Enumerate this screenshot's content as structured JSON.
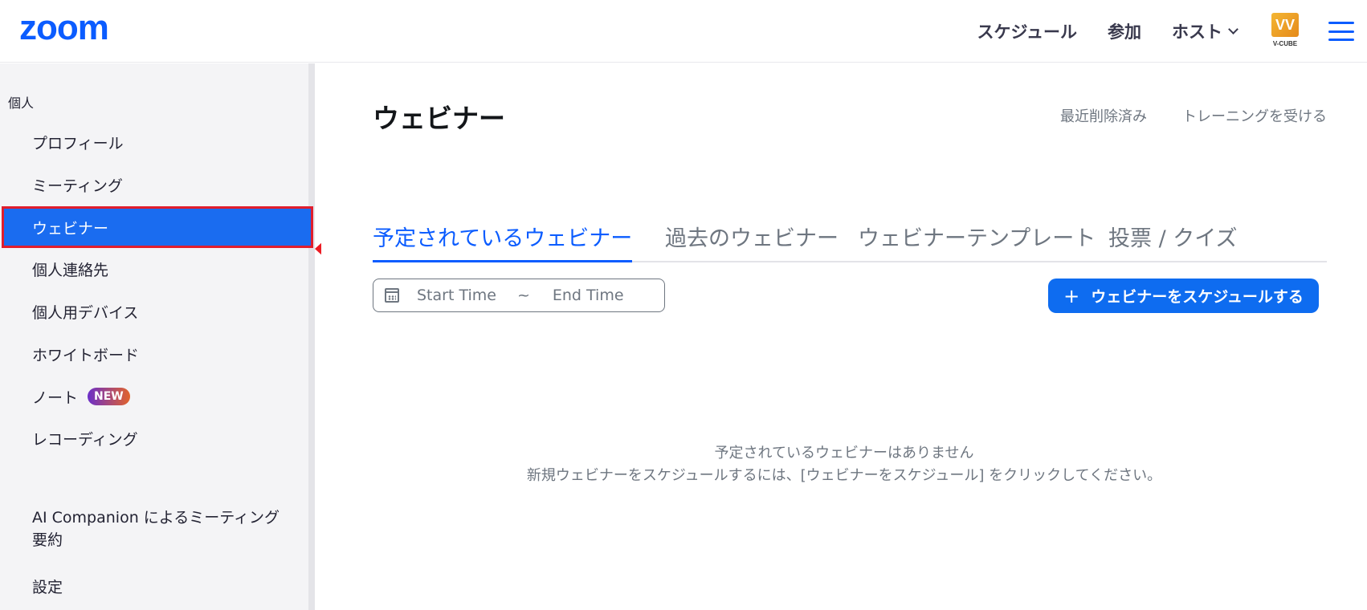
{
  "header": {
    "logo": "zoom",
    "nav": {
      "schedule": "スケジュール",
      "join": "参加",
      "host": "ホスト"
    },
    "vcube_logo_text": "V-CUBE",
    "vcube_mark": "VV"
  },
  "sidebar": {
    "section": "個人",
    "items": [
      {
        "label": "プロフィール"
      },
      {
        "label": "ミーティング"
      },
      {
        "label": "ウェビナー"
      },
      {
        "label": "個人連絡先"
      },
      {
        "label": "個人用デバイス"
      },
      {
        "label": "ホワイトボード"
      },
      {
        "label": "ノート",
        "badge": "NEW"
      },
      {
        "label": "レコーディング"
      },
      {
        "label": "AI Companion によるミーティング要約"
      },
      {
        "label": "設定"
      }
    ]
  },
  "main": {
    "title": "ウェビナー",
    "links": {
      "recently_deleted": "最近削除済み",
      "training": "トレーニングを受ける"
    },
    "tabs": [
      {
        "label": "予定されているウェビナー"
      },
      {
        "label": "過去のウェビナー"
      },
      {
        "label": "ウェビナーテンプレート"
      },
      {
        "label": "投票 / クイズ"
      }
    ],
    "date_range": {
      "start": "Start Time",
      "separator": "~",
      "end": "End Time"
    },
    "schedule_button": {
      "icon": "+",
      "label": "ウェビナーをスケジュールする"
    },
    "empty_state": {
      "line1": "予定されているウェビナーはありません",
      "line2": "新規ウェビナーをスケジュールするには、[ウェビナーをスケジュール] をクリックしてください。"
    }
  },
  "colors": {
    "accent": "#0b5cff",
    "active_item": "#1a6cf0",
    "highlight_border": "#e01e2d",
    "arrow": "#ec1c24"
  }
}
